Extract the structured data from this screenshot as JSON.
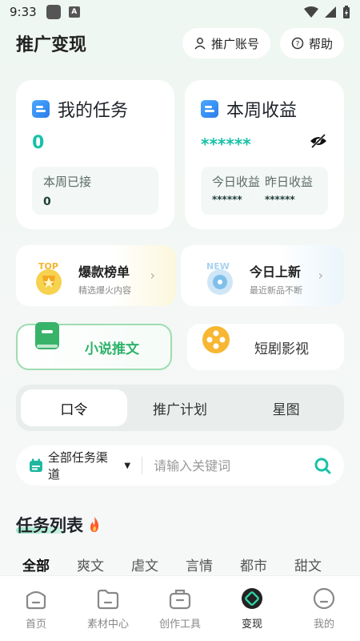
{
  "status": {
    "time": "9:33",
    "a_badge": "A"
  },
  "header": {
    "title": "推广变现",
    "account_btn": "推广账号",
    "help_btn": "帮助"
  },
  "tasks_card": {
    "title": "我的任务",
    "count": "0",
    "week_label": "本周已接",
    "week_value": "0"
  },
  "earnings_card": {
    "title": "本周收益",
    "masked": "******",
    "today_label": "今日收益",
    "today_value": "******",
    "yesterday_label": "昨日收益",
    "yesterday_value": "******"
  },
  "promos": [
    {
      "badge": "TOP",
      "title": "爆款榜单",
      "subtitle": "精选爆火内容"
    },
    {
      "badge": "NEW",
      "title": "今日上新",
      "subtitle": "最近新品不断"
    }
  ],
  "categories_big": {
    "novel": "小说推文",
    "drama": "短剧影视"
  },
  "segment": [
    "口令",
    "推广计划",
    "星图"
  ],
  "search": {
    "filter_label": "全部任务渠道",
    "placeholder": "请输入关键词"
  },
  "task_list": {
    "title": "任务列表",
    "categories": [
      "全部",
      "爽文",
      "虐文",
      "言情",
      "都市",
      "甜文"
    ]
  },
  "bottom_nav": [
    "首页",
    "素材中心",
    "创作工具",
    "变现",
    "我的"
  ],
  "colors": {
    "accent": "#18c1a7",
    "active_green": "#2fb26b"
  }
}
